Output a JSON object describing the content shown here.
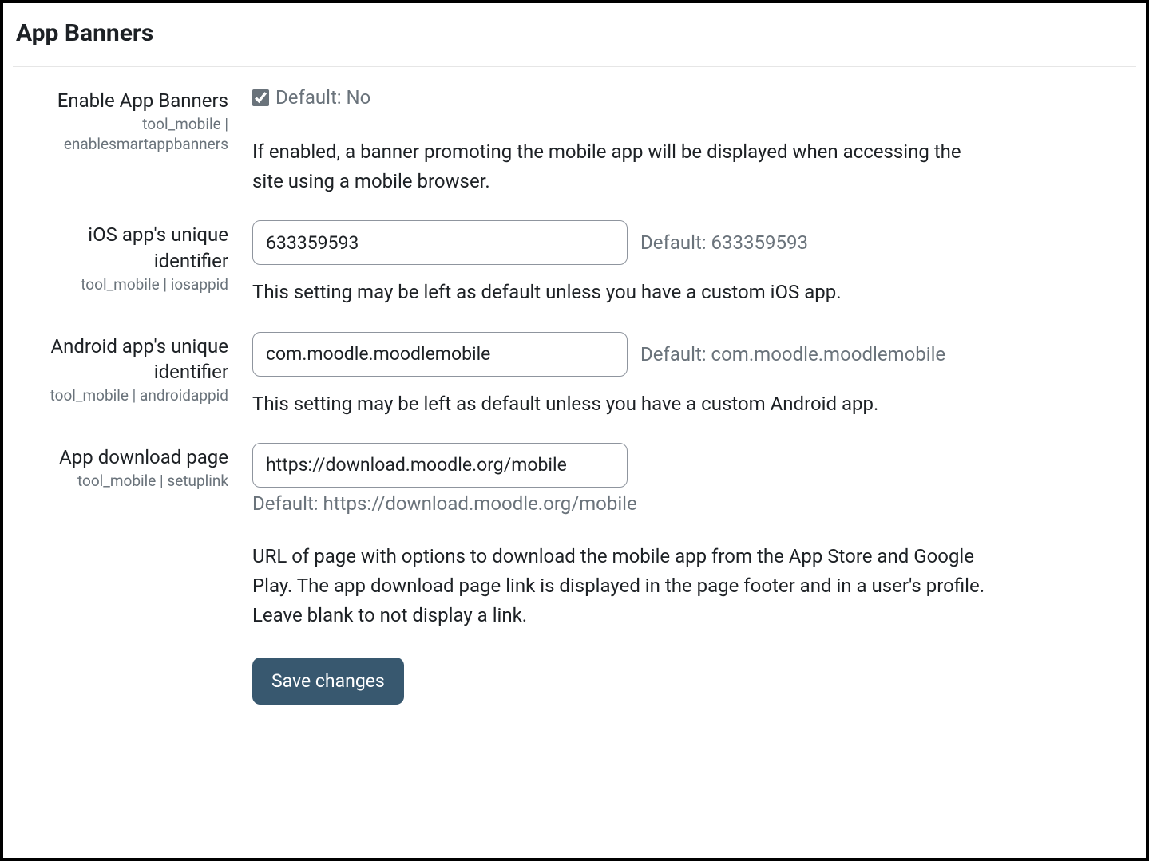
{
  "section_title": "App Banners",
  "settings": {
    "enable": {
      "label": "Enable App Banners",
      "sublabel": "tool_mobile | enablesmartappbanners",
      "checked": true,
      "default_text": "Default: No",
      "description": "If enabled, a banner promoting the mobile app will be displayed when accessing the site using a mobile browser."
    },
    "iosappid": {
      "label": "iOS app's unique identifier",
      "sublabel": "tool_mobile | iosappid",
      "value": "633359593",
      "default_text": "Default: 633359593",
      "description": "This setting may be left as default unless you have a custom iOS app."
    },
    "androidappid": {
      "label": "Android app's unique identifier",
      "sublabel": "tool_mobile | androidappid",
      "value": "com.moodle.moodlemobile",
      "default_text": "Default: com.moodle.moodlemobile",
      "description": "This setting may be left as default unless you have a custom Android app."
    },
    "setuplink": {
      "label": "App download page",
      "sublabel": "tool_mobile | setuplink",
      "value": "https://download.moodle.org/mobile",
      "default_text": "Default: https://download.moodle.org/mobile",
      "description": "URL of page with options to download the mobile app from the App Store and Google Play. The app download page link is displayed in the page footer and in a user's profile. Leave blank to not display a link."
    }
  },
  "save_button_label": "Save changes"
}
